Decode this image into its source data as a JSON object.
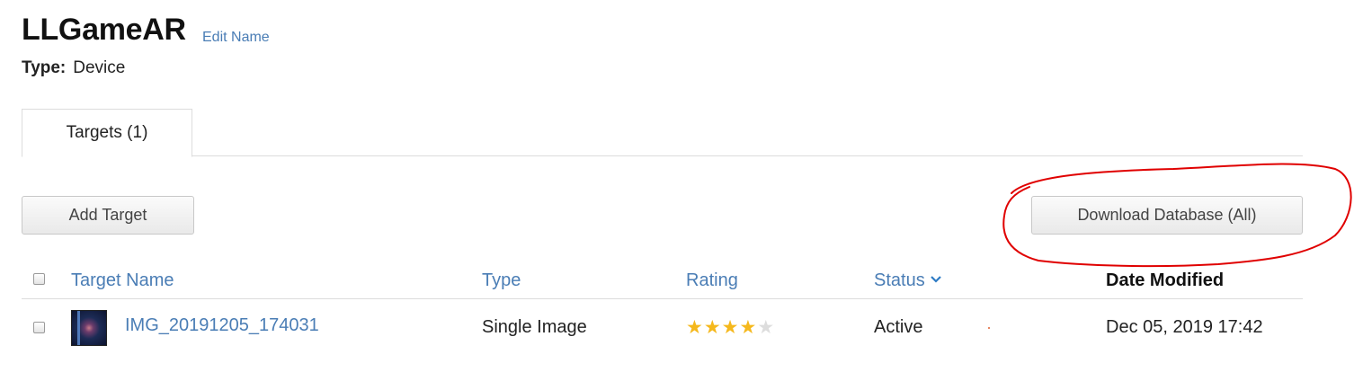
{
  "header": {
    "title": "LLGameAR",
    "edit_label": "Edit Name",
    "type_label": "Type:",
    "type_value": "Device"
  },
  "tabs": [
    {
      "label": "Targets (1)",
      "active": true
    }
  ],
  "toolbar": {
    "add_label": "Add Target",
    "download_label": "Download Database (All)"
  },
  "annotation": {
    "color": "#e00000",
    "shape": "hand-drawn ellipse around download button"
  },
  "table": {
    "columns": {
      "name": "Target Name",
      "type": "Type",
      "rating": "Rating",
      "status": "Status",
      "date": "Date Modified"
    },
    "status_sort_icon": "chevron-down-icon",
    "rows": [
      {
        "thumbnail_icon": "image-thumbnail",
        "name": "IMG_20191205_174031",
        "type": "Single Image",
        "rating": 4,
        "rating_max": 5,
        "status": "Active",
        "date": "Dec 05, 2019 17:42"
      }
    ]
  },
  "colors": {
    "link": "#4a7db5",
    "star_filled": "#f5b81c",
    "star_empty": "#dddddd",
    "annotation": "#e00000"
  }
}
